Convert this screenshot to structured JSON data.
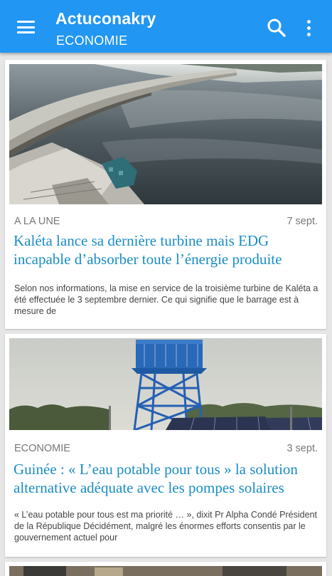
{
  "appbar": {
    "title": "Actuconakry",
    "section": "ECONOMIE",
    "menu_icon": "hamburger-menu-icon",
    "search_icon": "search-icon",
    "more_icon": "more-vert-icon",
    "color": "#2196f3"
  },
  "articles": [
    {
      "category": "A LA UNE",
      "date": "7 sept.",
      "title": "Kaléta lance sa dernière turbine mais EDG incapable d’absorber toute l’énergie produite",
      "excerpt": "Selon nos informations, la mise en service de la troisième turbine de Kaléta a été effectuée le 3 septembre dernier. Ce qui signifie que le barrage est à mesure de",
      "image": "dam-reservoir-photo"
    },
    {
      "category": "ECONOMIE",
      "date": "3 sept.",
      "title": "Guinée : « L’eau potable pour tous » la solution alternative adéquate avec les pompes solaires",
      "excerpt": "« L’eau potable pour tous est ma priorité … », dixit Pr Alpha Condé Président de la République Décidément, malgré les énormes efforts consentis par le gouvernement actuel pour",
      "image": "water-tower-solar-panels-photo"
    }
  ],
  "colors": {
    "headline": "#1a8dc4",
    "meta": "#777777",
    "background": "#e6e6e6"
  }
}
